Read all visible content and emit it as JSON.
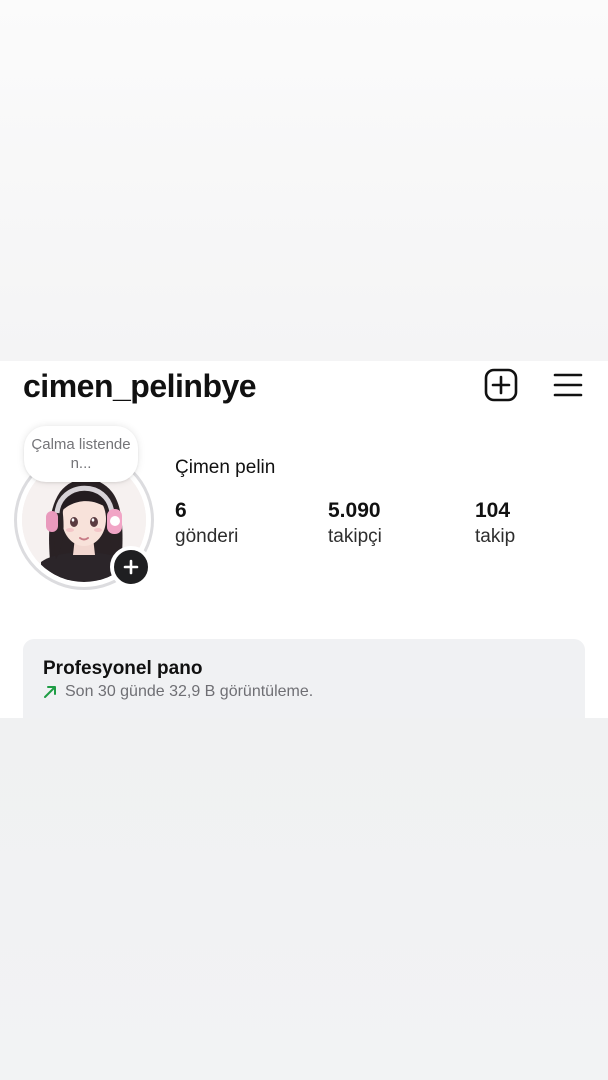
{
  "profile": {
    "username": "cimen_pelinbye",
    "full_name": "Çimen pelin",
    "note": "Çalma listende n...",
    "stats": [
      {
        "value": "6",
        "label": "gönderi"
      },
      {
        "value": "5.090",
        "label": "takipçi"
      },
      {
        "value": "104",
        "label": "takip"
      }
    ]
  },
  "header_icons": {
    "create": "plus-square-icon",
    "menu": "hamburger-menu-icon"
  },
  "dashboard": {
    "title": "Profesyonel pano",
    "subtitle": "Son 30 günde 32,9 B görüntüleme.",
    "trend_color": "#1f9d45"
  }
}
